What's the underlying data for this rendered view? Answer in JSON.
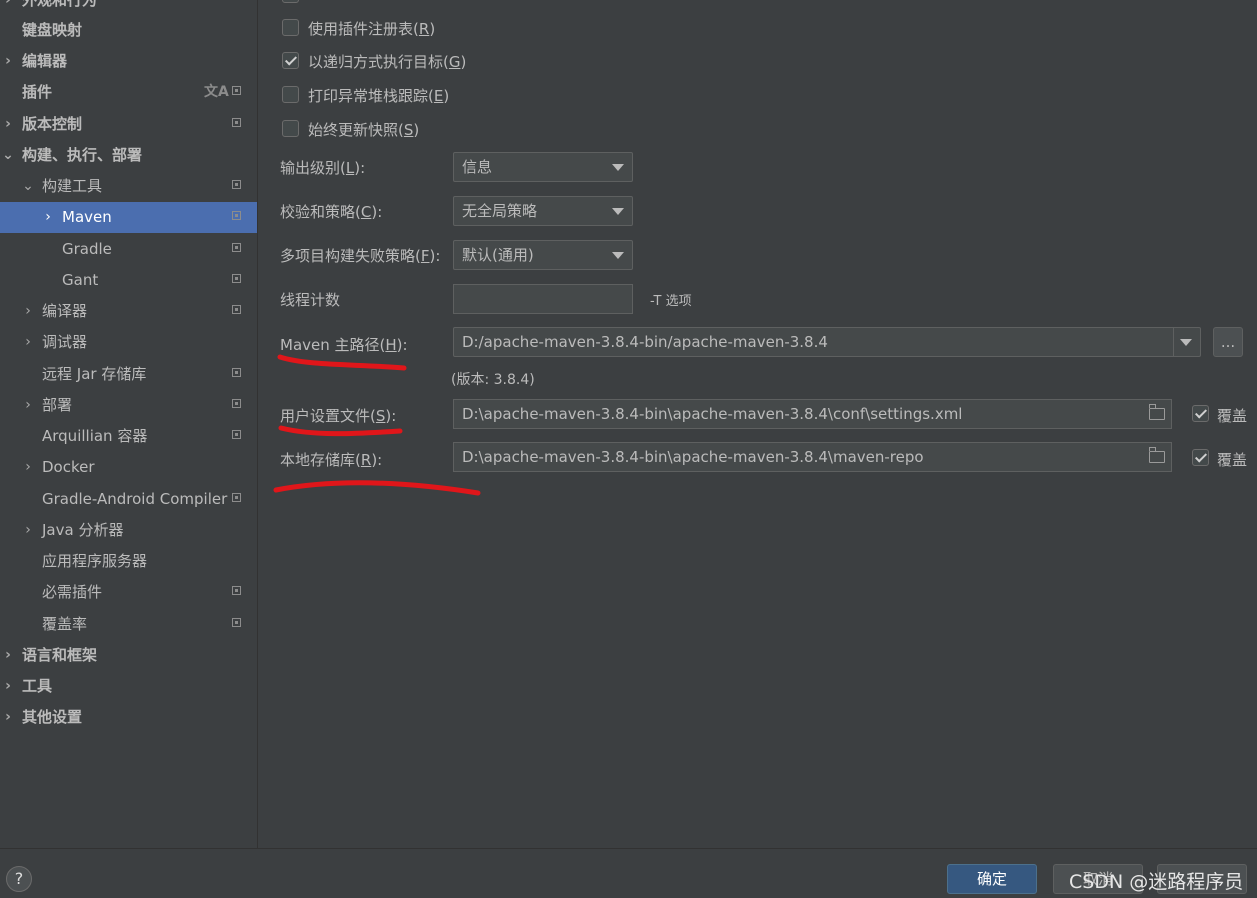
{
  "sidebar": {
    "items": [
      {
        "label": "外观和行为",
        "chevron": "›",
        "bold": true
      },
      {
        "label": "键盘映射",
        "chevron": "",
        "bold": true
      },
      {
        "label": "编辑器",
        "chevron": "›",
        "bold": true
      },
      {
        "label": "插件",
        "chevron": "",
        "bold": true
      },
      {
        "label": "版本控制",
        "chevron": "›",
        "bold": true
      },
      {
        "label": "构建、执行、部署",
        "chevron": "⌄",
        "bold": true
      },
      {
        "label": "构建工具",
        "chevron": "⌄"
      },
      {
        "label": "Maven",
        "chevron": "›"
      },
      {
        "label": "Gradle",
        "chevron": ""
      },
      {
        "label": "Gant",
        "chevron": ""
      },
      {
        "label": "编译器",
        "chevron": "›"
      },
      {
        "label": "调试器",
        "chevron": "›"
      },
      {
        "label": "远程 Jar 存储库",
        "chevron": ""
      },
      {
        "label": "部署",
        "chevron": "›"
      },
      {
        "label": "Arquillian 容器",
        "chevron": ""
      },
      {
        "label": "Docker",
        "chevron": "›"
      },
      {
        "label": "Gradle-Android Compiler",
        "chevron": ""
      },
      {
        "label": "Java 分析器",
        "chevron": "›"
      },
      {
        "label": "应用程序服务器",
        "chevron": ""
      },
      {
        "label": "必需插件",
        "chevron": ""
      },
      {
        "label": "覆盖率",
        "chevron": ""
      },
      {
        "label": "语言和框架",
        "chevron": "›",
        "bold": true
      },
      {
        "label": "工具",
        "chevron": "›",
        "bold": true
      },
      {
        "label": "其他设置",
        "chevron": "›",
        "bold": true
      }
    ],
    "selected": "Maven",
    "translate_icon": "文A"
  },
  "main": {
    "checkboxes": [
      {
        "text": "使用插件注册表",
        "mnemonic": "R",
        "checked": false
      },
      {
        "text": "以递归方式执行目标",
        "mnemonic": "G",
        "checked": true
      },
      {
        "text": "打印异常堆栈跟踪",
        "mnemonic": "E",
        "checked": false
      },
      {
        "text": "始终更新快照",
        "mnemonic": "S",
        "checked": false
      }
    ],
    "output_level": {
      "label": "输出级别",
      "mnemonic": "L",
      "value": "信息"
    },
    "checksum_policy": {
      "label": "校验和策略",
      "mnemonic": "C",
      "value": "无全局策略"
    },
    "fail_policy": {
      "label": "多项目构建失败策略",
      "mnemonic": "F",
      "value": "默认(通用)"
    },
    "thread_count": {
      "label": "线程计数",
      "value": "",
      "hint": "-T 选项"
    },
    "maven_home": {
      "label_prefix": "Maven 主路径",
      "mnemonic": "H",
      "value": "D:/apache-maven-3.8.4-bin/apache-maven-3.8.4",
      "browse": "...",
      "version": "(版本: 3.8.4)"
    },
    "settings_file": {
      "label": "用户设置文件",
      "mnemonic": "S",
      "value": "D:\\apache-maven-3.8.4-bin\\apache-maven-3.8.4\\conf\\settings.xml",
      "override": "覆盖",
      "override_checked": true
    },
    "local_repo": {
      "label": "本地存储库",
      "mnemonic": "R",
      "value": "D:\\apache-maven-3.8.4-bin\\apache-maven-3.8.4\\maven-repo",
      "override": "覆盖",
      "override_checked": true
    }
  },
  "footer": {
    "help": "?",
    "ok": "确定",
    "cancel": "取消",
    "watermark": "CSDN @迷路程序员"
  },
  "colors": {
    "background": "#3c3f41",
    "selection": "#4b6eaf",
    "primary_button": "#365880",
    "annotation": "#e0161a"
  }
}
